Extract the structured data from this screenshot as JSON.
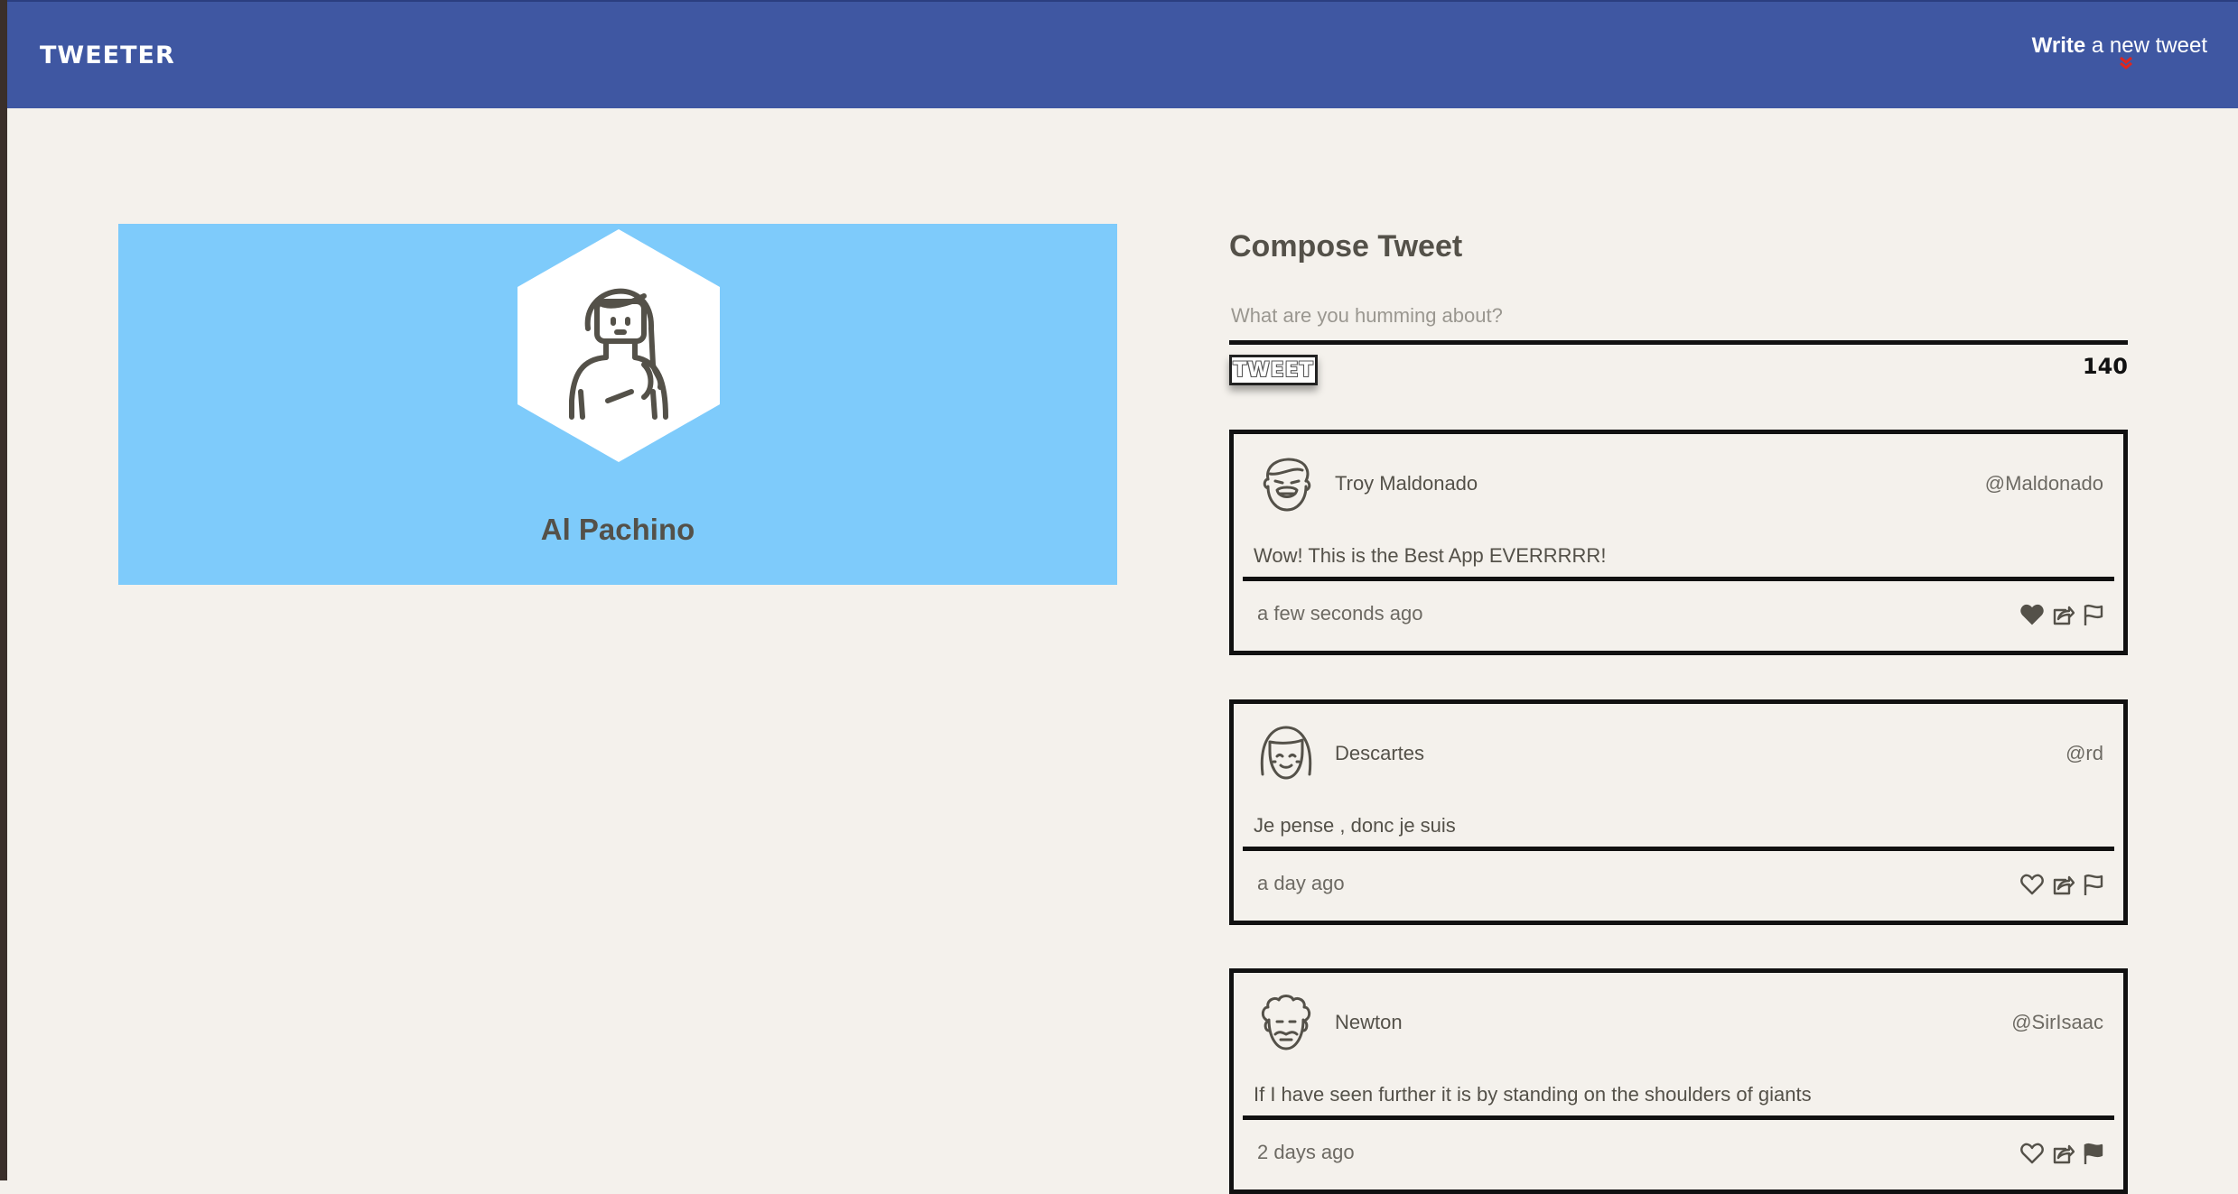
{
  "nav": {
    "brand": "TWEETER",
    "write_strong": "Write",
    "write_rest": " a new tweet",
    "chevron_icon": "chevron-double-down-icon",
    "chevron_color": "#e0261d",
    "bg_color": "#3f57a2"
  },
  "profile": {
    "name": "Al Pachino",
    "avatar_icon": "woman-avatar-icon",
    "bg_color": "#7ecbfb"
  },
  "compose": {
    "title": "Compose Tweet",
    "placeholder": "What are you humming about?",
    "button_label": "TWEET",
    "counter": "140"
  },
  "tweets": [
    {
      "name": "Troy Maldonado",
      "handle": "@Maldonado",
      "text": "Wow! This is the Best App EVERRRRR!",
      "time": "a few seconds ago",
      "avatar_icon": "laughing-man-avatar-icon",
      "liked": true,
      "flagged": false
    },
    {
      "name": "Descartes",
      "handle": "@rd",
      "text": "Je pense , donc je suis",
      "time": "a day ago",
      "avatar_icon": "bob-hair-avatar-icon",
      "liked": false,
      "flagged": false
    },
    {
      "name": "Newton",
      "handle": "@SirIsaac",
      "text": "If I have seen further it is by standing on the shoulders of giants",
      "time": "2 days ago",
      "avatar_icon": "curly-hair-avatar-icon",
      "liked": false,
      "flagged": true
    }
  ]
}
